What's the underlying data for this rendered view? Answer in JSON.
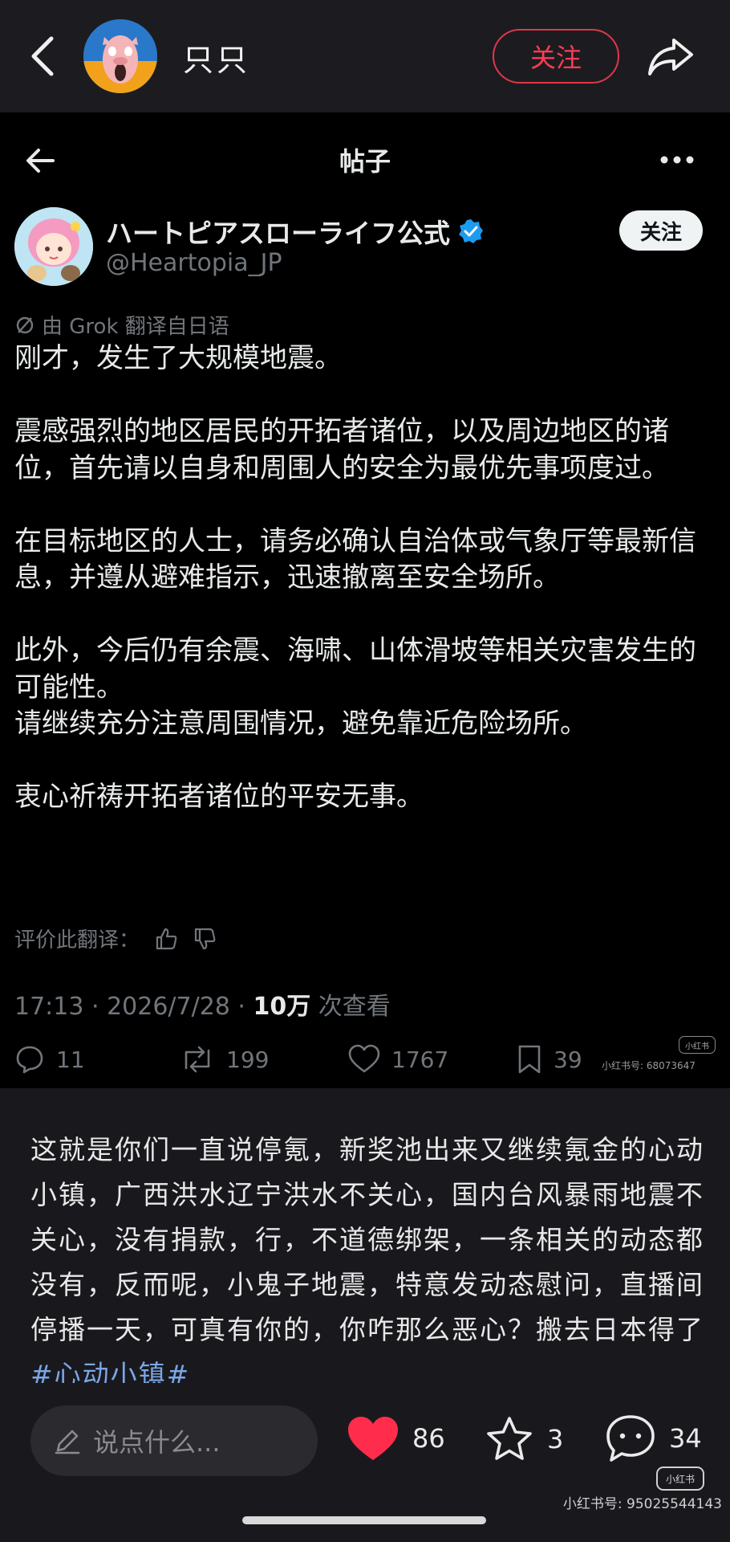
{
  "top_bar": {
    "username": "只只",
    "follow_label": "关注"
  },
  "x_post": {
    "header_title": "帖子",
    "account_name": "ハートピアスローライフ公式",
    "handle": "@Heartopia_JP",
    "follow_label": "关注",
    "translation_note": "由 Grok 翻译自日语",
    "paragraphs": [
      "刚才，发生了大规模地震。",
      "震感强烈的地区居民的开拓者诸位，以及周边地区的诸位，首先请以自身和周围人的安全为最优先事项度过。",
      "在目标地区的人士，请务必确认自治体或气象厅等最新信息，并遵从避难指示，迅速撤离至安全场所。",
      "此外，今后仍有余震、海啸、山体滑坡等相关灾害发生的可能性。\n请继续充分注意周围情况，避免靠近危险场所。",
      "衷心祈祷开拓者诸位的平安无事。"
    ],
    "rate_translation": "评价此翻译：",
    "timestamp": "17:13 · 2026/7/28 · ",
    "views_count": "10万",
    "views_label": " 次查看",
    "replies": "11",
    "reposts": "199",
    "likes": "1767",
    "bookmarks": "39",
    "watermark_small": "小红书号: 68073647"
  },
  "caption": {
    "text": "这就是你们一直说停氪，新奖池出来又继续氪金的心动小镇，广西洪水辽宁洪水不关心，国内台风暴雨地震不关心，没有捐款，行，不道德绑架，一条相关的动态都没有，反而呢，小鬼子地震，特意发动态慰问，直播间停播一天，可真有你的，你咋那么恶心？搬去日本得了",
    "hashtag": "#心动小镇#"
  },
  "bottom_bar": {
    "comment_placeholder": "说点什么...",
    "likes": "86",
    "favorites": "3",
    "comments": "34"
  },
  "watermark": {
    "logo_text": "小红书",
    "id_text": "小红书号: 95025544143"
  },
  "colors": {
    "follow_red": "#ff3d53",
    "like_red": "#ff2d4b",
    "verified_blue": "#1d9bf0",
    "hashtag_blue": "#7ba6e6"
  }
}
